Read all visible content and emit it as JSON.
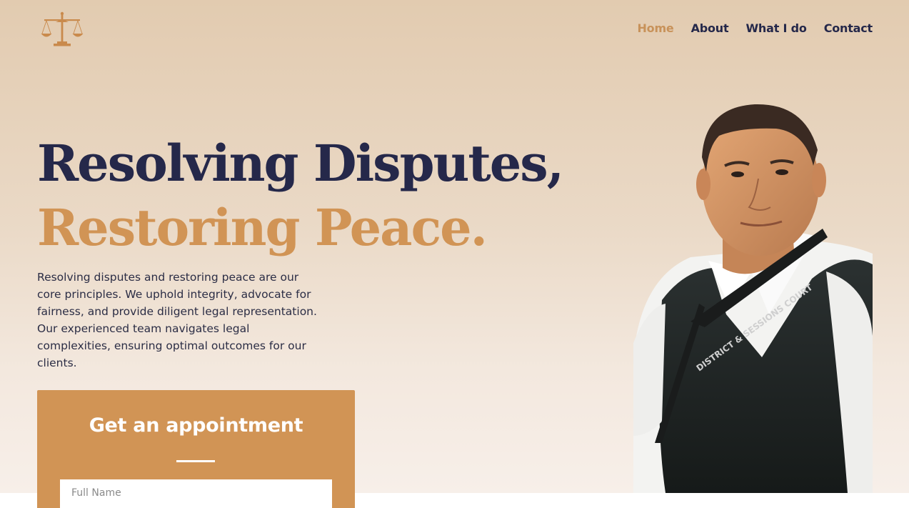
{
  "header": {
    "logo_icon": "scales-of-justice-icon",
    "nav": [
      {
        "label": "Home",
        "active": true
      },
      {
        "label": "About",
        "active": false
      },
      {
        "label": "What I do",
        "active": false
      },
      {
        "label": "Contact",
        "active": false
      }
    ]
  },
  "hero": {
    "headline_line1": "Resolving Disputes,",
    "headline_line2": "Restoring Peace.",
    "intro": "Resolving disputes and restoring peace are our core principles. We uphold integrity, advocate for fairness, and provide diligent legal representation. Our experienced team navigates legal complexities, ensuring optimal outcomes for our clients.",
    "portrait_lanyard_text": "DISTRICT & SESSIONS COURT"
  },
  "appointment": {
    "title": "Get an appointment",
    "name_placeholder": "Full Name"
  },
  "colors": {
    "navy": "#25284a",
    "accent": "#d19455",
    "hero_top": "#e2cbb0",
    "hero_bottom": "#f7efe9"
  }
}
